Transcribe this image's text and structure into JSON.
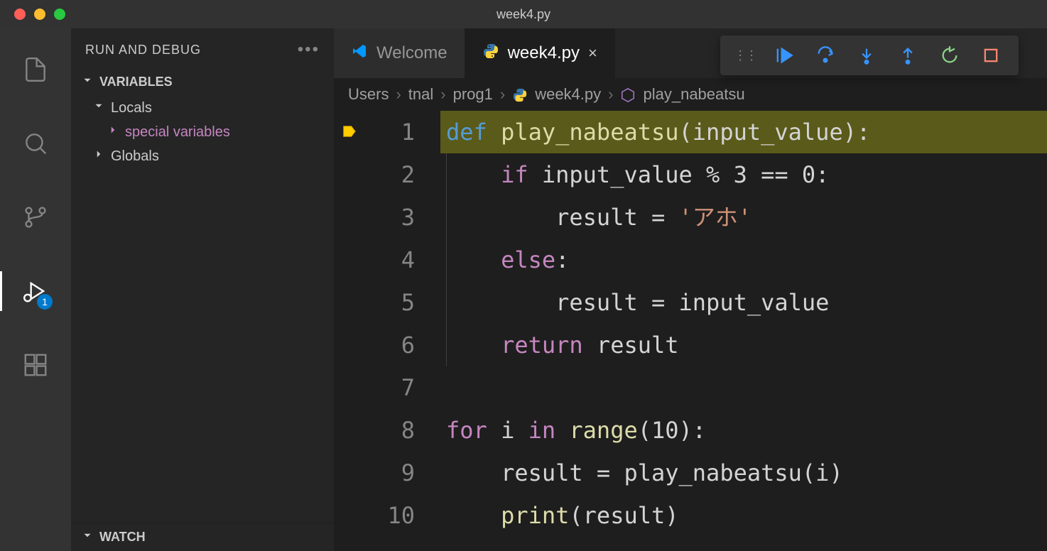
{
  "window": {
    "title": "week4.py"
  },
  "sidebar": {
    "header": "RUN AND DEBUG",
    "sections": {
      "variables": {
        "title": "VARIABLES",
        "locals_label": "Locals",
        "special_label": "special variables",
        "globals_label": "Globals"
      },
      "watch": {
        "title": "WATCH"
      }
    }
  },
  "activity": {
    "debug_badge": "1"
  },
  "tabs": [
    {
      "label": "Welcome",
      "active": false
    },
    {
      "label": "week4.py",
      "active": true
    }
  ],
  "breadcrumb": {
    "parts": [
      "Users",
      "tnal",
      "prog1",
      "week4.py",
      "play_nabeatsu"
    ]
  },
  "editor": {
    "line_numbers": [
      "1",
      "2",
      "3",
      "4",
      "5",
      "6",
      "7",
      "8",
      "9",
      "10"
    ],
    "current_line": 1,
    "code": {
      "l1": {
        "def": "def",
        "fn": "play_nabeatsu",
        "params": "(input_value):"
      },
      "l2": {
        "kw": "if",
        "rest": " input_value % 3 == 0:"
      },
      "l3": {
        "pre": "        result = ",
        "str": "'アホ'"
      },
      "l4": {
        "kw": "else",
        "colon": ":"
      },
      "l5": "        result = input_value",
      "l6": {
        "kw": "return",
        "rest": " result"
      },
      "l7": "",
      "l8": {
        "for": "for",
        "mid": " i ",
        "in": "in",
        "fn": " range",
        "rest": "(10):"
      },
      "l9": "    result = play_nabeatsu(i)",
      "l10": {
        "pre": "    ",
        "fn": "print",
        "rest": "(result)"
      }
    }
  }
}
